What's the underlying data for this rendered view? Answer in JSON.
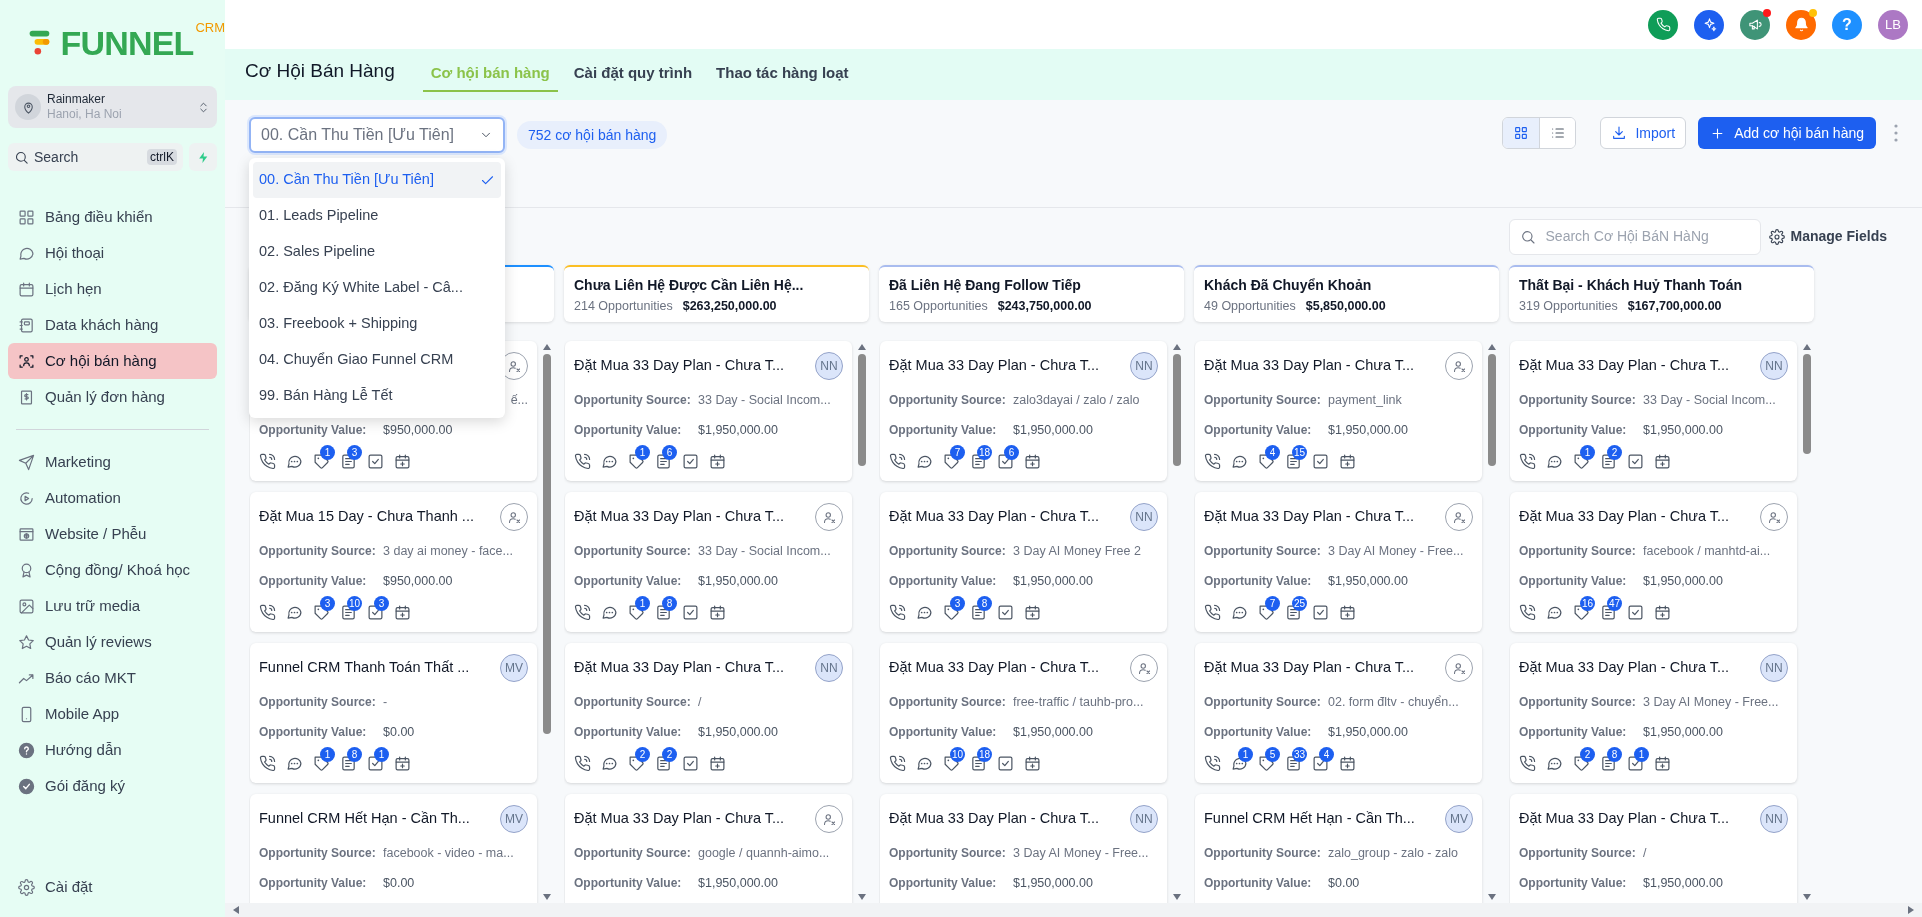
{
  "sidebar": {
    "logo": {
      "text": "FUNNEL",
      "superscript": "CRM"
    },
    "account": {
      "name": "Rainmaker",
      "location": "Hanoi, Ha Noi"
    },
    "search": {
      "placeholder": "Search",
      "shortcut": "ctrlK"
    },
    "nav_groups": [
      [
        {
          "label": "Bảng điều khiển",
          "selected": false
        },
        {
          "label": "Hội thoại",
          "selected": false
        },
        {
          "label": "Lịch hẹn",
          "selected": false
        },
        {
          "label": "Data khách hàng",
          "selected": false
        },
        {
          "label": "Cơ hội bán hàng",
          "selected": true
        },
        {
          "label": "Quản lý đơn hàng",
          "selected": false
        }
      ],
      [
        {
          "label": "Marketing",
          "selected": false
        },
        {
          "label": "Automation",
          "selected": false
        },
        {
          "label": "Website / Phễu",
          "selected": false
        },
        {
          "label": "Cộng đồng/ Khoá học",
          "selected": false
        },
        {
          "label": "Lưu trữ media",
          "selected": false
        },
        {
          "label": "Quản lý reviews",
          "selected": false
        },
        {
          "label": "Báo cáo MKT",
          "selected": false
        },
        {
          "label": "Mobile App",
          "selected": false
        },
        {
          "label": "Hướng dẫn",
          "selected": false
        },
        {
          "label": "Gói đăng ký",
          "selected": false
        }
      ]
    ],
    "settings": {
      "label": "Cài đặt"
    }
  },
  "topbar": {
    "buttons": [
      {
        "color": "#0f9d58"
      },
      {
        "color": "#1d5ff0"
      },
      {
        "color": "#3f9477",
        "dot": {
          "color": "#ff1a1a"
        }
      },
      {
        "color": "#ff6a00",
        "dot": {
          "color": "#ffc107"
        }
      },
      {
        "color": "#1e90ff",
        "label": "?"
      }
    ],
    "user_avatar": {
      "initials": "LB",
      "color": "#ac78c4"
    }
  },
  "header": {
    "title": "Cơ Hội Bán Hàng",
    "tabs": [
      {
        "label": "Cơ hội bán hàng",
        "selected": true
      },
      {
        "label": "Cài đặt quy trình",
        "selected": false
      },
      {
        "label": "Thao tác hàng loạt",
        "selected": false
      }
    ]
  },
  "pipeline_select": {
    "value": "00. Cần Thu Tiền [Ưu Tiên]",
    "expanded": true,
    "options": [
      {
        "label": "00. Cần Thu Tiền [Ưu Tiên]",
        "selected": true
      },
      {
        "label": "01. Leads Pipeline",
        "selected": false
      },
      {
        "label": "02. Sales Pipeline",
        "selected": false
      },
      {
        "label": "02. Đăng Ký White Label - Câ...",
        "selected": false
      },
      {
        "label": "03. Freebook + Shipping",
        "selected": false
      },
      {
        "label": "04. Chuyển Giao Funnel CRM",
        "selected": false
      },
      {
        "label": "99. Bán Hàng Lễ Tết",
        "selected": false
      }
    ]
  },
  "count_badge": "752 cơ hội bán hàng",
  "view_toggle": [
    {
      "selected": true
    },
    {
      "selected": false
    }
  ],
  "import_button": "Import",
  "add_button": "Add cơ hội bán hàng",
  "board_search": {
    "placeholder": "Search Cơ Hội BáN HàNg"
  },
  "manage_fields": "Manage Fields",
  "columns": [
    {
      "color": "#1e90ff",
      "cards": [
        {
          "assignee": {
            "kind": "unassigned"
          },
          "source": "ế...",
          "value_label": "Opportunity Value:",
          "value": "$950,000.00",
          "badges": {
            "tags": "1",
            "notes": "3"
          }
        },
        {
          "title": "Đặt Mua 15 Day - Chưa Thanh ...",
          "assignee": {
            "kind": "unassigned"
          },
          "source_label": "Opportunity Source:",
          "source": "3 day ai money - face...",
          "value_label": "Opportunity Value:",
          "value": "$950,000.00",
          "badges": {
            "tags": "3",
            "notes": "10",
            "tasks": "3"
          }
        },
        {
          "title": "Funnel CRM Thanh Toán Thất ...",
          "assignee": {
            "kind": "initials",
            "initials": "MV"
          },
          "source_label": "Opportunity Source:",
          "source": "-",
          "value_label": "Opportunity Value:",
          "value": "$0.00",
          "badges": {
            "tags": "1",
            "notes": "8",
            "tasks": "1"
          }
        },
        {
          "title": "Funnel CRM Hết Hạn - Cần Th...",
          "assignee": {
            "kind": "initials",
            "initials": "MV"
          },
          "source_label": "Opportunity Source:",
          "source": "facebook - video - ma...",
          "value_label": "Opportunity Value:",
          "value": "$0.00"
        }
      ]
    },
    {
      "title": "Chưa Liên Hệ Được Cần Liên Hệ...",
      "count": "214 Opportunities",
      "total": "$263,250,000.00",
      "color": "#fbbf24",
      "cards": [
        {
          "title": "Đặt Mua 33 Day Plan - Chưa T...",
          "assignee": {
            "kind": "initials",
            "initials": "NN"
          },
          "source_label": "Opportunity Source:",
          "source": "33 Day - Social Incom...",
          "value_label": "Opportunity Value:",
          "value": "$1,950,000.00",
          "badges": {
            "tags": "1",
            "notes": "6"
          }
        },
        {
          "title": "Đặt Mua 33 Day Plan - Chưa T...",
          "assignee": {
            "kind": "unassigned"
          },
          "source_label": "Opportunity Source:",
          "source": "33 Day - Social Incom...",
          "value_label": "Opportunity Value:",
          "value": "$1,950,000.00",
          "badges": {
            "tags": "1",
            "notes": "8"
          }
        },
        {
          "title": "Đặt Mua 33 Day Plan - Chưa T...",
          "assignee": {
            "kind": "initials",
            "initials": "NN"
          },
          "source_label": "Opportunity Source:",
          "source": "/",
          "value_label": "Opportunity Value:",
          "value": "$1,950,000.00",
          "badges": {
            "tags": "2",
            "notes": "2"
          }
        },
        {
          "title": "Đặt Mua 33 Day Plan - Chưa T...",
          "assignee": {
            "kind": "unassigned"
          },
          "source_label": "Opportunity Source:",
          "source": "google / quannh-aimo...",
          "value_label": "Opportunity Value:",
          "value": "$1,950,000.00"
        }
      ]
    },
    {
      "title": "Đã Liên Hệ Đang Follow Tiếp",
      "count": "165 Opportunities",
      "total": "$243,750,000.00",
      "color": "#a9bcef",
      "cards": [
        {
          "title": "Đặt Mua 33 Day Plan - Chưa T...",
          "assignee": {
            "kind": "initials",
            "initials": "NN"
          },
          "source_label": "Opportunity Source:",
          "source": "zalo3dayai / zalo / zalo",
          "value_label": "Opportunity Value:",
          "value": "$1,950,000.00",
          "badges": {
            "tags": "7",
            "notes": "18",
            "tasks": "6"
          }
        },
        {
          "title": "Đặt Mua 33 Day Plan - Chưa T...",
          "assignee": {
            "kind": "initials",
            "initials": "NN"
          },
          "source_label": "Opportunity Source:",
          "source": "3 Day AI Money Free 2",
          "value_label": "Opportunity Value:",
          "value": "$1,950,000.00",
          "badges": {
            "tags": "3",
            "notes": "8"
          }
        },
        {
          "title": "Đặt Mua 33 Day Plan - Chưa T...",
          "assignee": {
            "kind": "unassigned"
          },
          "source_label": "Opportunity Source:",
          "source": "free-traffic / tauhb-pro...",
          "value_label": "Opportunity Value:",
          "value": "$1,950,000.00",
          "badges": {
            "tags": "10",
            "notes": "18"
          }
        },
        {
          "title": "Đặt Mua 33 Day Plan - Chưa T...",
          "assignee": {
            "kind": "initials",
            "initials": "NN"
          },
          "source_label": "Opportunity Source:",
          "source": "3 Day AI Money - Free...",
          "value_label": "Opportunity Value:",
          "value": "$1,950,000.00"
        }
      ]
    },
    {
      "title": "Khách Đã Chuyển Khoản",
      "count": "49 Opportunities",
      "total": "$5,850,000.00",
      "color": "#a9bcef",
      "cards": [
        {
          "title": "Đặt Mua 33 Day Plan - Chưa T...",
          "assignee": {
            "kind": "unassigned"
          },
          "source_label": "Opportunity Source:",
          "source": "payment_link",
          "value_label": "Opportunity Value:",
          "value": "$1,950,000.00",
          "badges": {
            "tags": "4",
            "notes": "15"
          }
        },
        {
          "title": "Đặt Mua 33 Day Plan - Chưa T...",
          "assignee": {
            "kind": "unassigned"
          },
          "source_label": "Opportunity Source:",
          "source": "3 Day AI Money - Free...",
          "value_label": "Opportunity Value:",
          "value": "$1,950,000.00",
          "badges": {
            "tags": "7",
            "notes": "25"
          }
        },
        {
          "title": "Đặt Mua 33 Day Plan - Chưa T...",
          "assignee": {
            "kind": "unassigned"
          },
          "source_label": "Opportunity Source:",
          "source": "02. form đltv - chuyển...",
          "value_label": "Opportunity Value:",
          "value": "$1,950,000.00",
          "badges": {
            "messages": "1",
            "tags": "5",
            "notes": "33",
            "tasks": "4"
          }
        },
        {
          "title": "Funnel CRM Hết Hạn - Cần Th...",
          "assignee": {
            "kind": "initials",
            "initials": "MV"
          },
          "source_label": "Opportunity Source:",
          "source": "zalo_group - zalo - zalo",
          "value_label": "Opportunity Value:",
          "value": "$0.00"
        }
      ]
    },
    {
      "title": "Thất Bại - Khách Huỷ Thanh Toán",
      "count": "319 Opportunities",
      "total": "$167,700,000.00",
      "color": "#a9bcef",
      "cards": [
        {
          "title": "Đặt Mua 33 Day Plan - Chưa T...",
          "assignee": {
            "kind": "initials",
            "initials": "NN"
          },
          "source_label": "Opportunity Source:",
          "source": "33 Day - Social Incom...",
          "value_label": "Opportunity Value:",
          "value": "$1,950,000.00",
          "badges": {
            "tags": "1",
            "notes": "2"
          }
        },
        {
          "title": "Đặt Mua 33 Day Plan - Chưa T...",
          "assignee": {
            "kind": "unassigned"
          },
          "source_label": "Opportunity Source:",
          "source": "facebook / manhtd-ai...",
          "value_label": "Opportunity Value:",
          "value": "$1,950,000.00",
          "badges": {
            "tags": "16",
            "notes": "47"
          }
        },
        {
          "title": "Đặt Mua 33 Day Plan - Chưa T...",
          "assignee": {
            "kind": "initials",
            "initials": "NN"
          },
          "source_label": "Opportunity Source:",
          "source": "3 Day AI Money - Free...",
          "value_label": "Opportunity Value:",
          "value": "$1,950,000.00",
          "badges": {
            "tags": "2",
            "notes": "8",
            "tasks": "1"
          }
        },
        {
          "title": "Đặt Mua 33 Day Plan - Chưa T...",
          "assignee": {
            "kind": "initials",
            "initials": "NN"
          },
          "source_label": "Opportunity Source:",
          "source": "/",
          "value_label": "Opportunity Value:",
          "value": "$1,950,000.00"
        }
      ]
    }
  ]
}
